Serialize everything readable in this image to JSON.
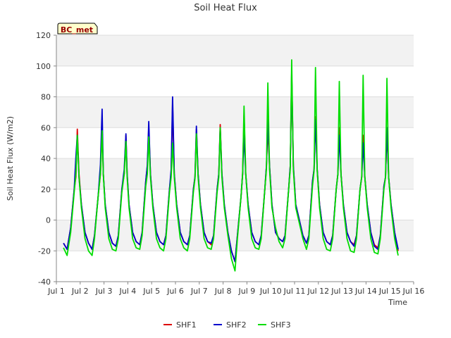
{
  "chart_data": {
    "type": "line",
    "title": "Soil Heat Flux",
    "badge": "BC_met",
    "xlabel": "Time",
    "ylabel": "Soil Heat Flux (W/m2)",
    "xlim": [
      1,
      16
    ],
    "ylim": [
      -40,
      120
    ],
    "yticks": [
      -40,
      -20,
      0,
      20,
      40,
      60,
      80,
      100,
      120
    ],
    "xticks": [
      {
        "v": 1,
        "label": "Jul 1"
      },
      {
        "v": 2,
        "label": "Jul 2"
      },
      {
        "v": 3,
        "label": "Jul 3"
      },
      {
        "v": 4,
        "label": "Jul 4"
      },
      {
        "v": 5,
        "label": "Jul 5"
      },
      {
        "v": 6,
        "label": "Jul 6"
      },
      {
        "v": 7,
        "label": "Jul 7"
      },
      {
        "v": 8,
        "label": "Jul 8"
      },
      {
        "v": 9,
        "label": "Jul 9"
      },
      {
        "v": 10,
        "label": "Jul 10"
      },
      {
        "v": 11,
        "label": "Jul 11"
      },
      {
        "v": 12,
        "label": "Jul 12"
      },
      {
        "v": 13,
        "label": "Jul 13"
      },
      {
        "v": 14,
        "label": "Jul 14"
      },
      {
        "v": 15,
        "label": "Jul 15"
      },
      {
        "v": 16,
        "label": "Jul 16"
      }
    ],
    "grid": true,
    "legend_position": "bottom",
    "series": [
      {
        "name": "SHF1",
        "color": "#dd0000",
        "x": [
          1.3,
          1.45,
          1.6,
          1.75,
          1.82,
          1.88,
          1.95,
          2.05,
          2.2,
          2.35,
          2.5,
          2.6,
          2.75,
          2.85,
          2.92,
          2.97,
          3.05,
          3.2,
          3.35,
          3.5,
          3.6,
          3.75,
          3.85,
          3.92,
          3.97,
          4.05,
          4.2,
          4.35,
          4.5,
          4.6,
          4.75,
          4.82,
          4.88,
          4.95,
          5.05,
          5.2,
          5.35,
          5.5,
          5.6,
          5.75,
          5.82,
          5.88,
          5.95,
          6.05,
          6.2,
          6.35,
          6.5,
          6.6,
          6.75,
          6.82,
          6.88,
          6.95,
          7.05,
          7.2,
          7.35,
          7.5,
          7.6,
          7.75,
          7.82,
          7.88,
          7.95,
          8.05,
          8.2,
          8.35,
          8.5,
          8.6,
          8.75,
          8.82,
          8.88,
          8.95,
          9.05,
          9.2,
          9.35,
          9.5,
          9.6,
          9.75,
          9.82,
          9.88,
          9.95,
          10.05,
          10.2,
          10.35,
          10.5,
          10.6,
          10.75,
          10.82,
          10.88,
          10.95,
          11.05,
          11.2,
          11.35,
          11.5,
          11.6,
          11.75,
          11.82,
          11.88,
          11.95,
          12.05,
          12.2,
          12.35,
          12.5,
          12.6,
          12.75,
          12.82,
          12.88,
          12.95,
          13.05,
          13.2,
          13.35,
          13.5,
          13.6,
          13.75,
          13.82,
          13.88,
          13.95,
          14.05,
          14.2,
          14.35,
          14.5,
          14.6,
          14.75,
          14.82,
          14.88,
          14.95,
          15.05,
          15.2,
          15.35
        ],
        "y": [
          -15,
          -19,
          -5,
          20,
          28,
          59,
          30,
          10,
          -8,
          -15,
          -19,
          -10,
          15,
          30,
          60,
          30,
          10,
          -8,
          -15,
          -17,
          -10,
          20,
          30,
          55,
          30,
          10,
          -8,
          -14,
          -16,
          -8,
          25,
          35,
          60,
          30,
          10,
          -8,
          -14,
          -16,
          -10,
          20,
          30,
          75,
          30,
          10,
          -8,
          -14,
          -16,
          -10,
          20,
          28,
          59,
          30,
          10,
          -8,
          -14,
          -16,
          -10,
          20,
          30,
          62,
          30,
          10,
          -8,
          -20,
          -27,
          -10,
          15,
          30,
          68,
          30,
          10,
          -8,
          -14,
          -16,
          -10,
          20,
          35,
          60,
          35,
          10,
          -8,
          -12,
          -14,
          -10,
          20,
          35,
          95,
          35,
          10,
          0,
          -10,
          -15,
          -10,
          25,
          33,
          67,
          33,
          10,
          -8,
          -14,
          -16,
          -10,
          20,
          30,
          60,
          30,
          10,
          -8,
          -14,
          -16,
          -10,
          20,
          28,
          55,
          28,
          10,
          -8,
          -16,
          -18,
          -10,
          22,
          28,
          58,
          28,
          10,
          -8,
          -20
        ]
      },
      {
        "name": "SHF2",
        "color": "#0000cc",
        "x": [
          1.3,
          1.45,
          1.6,
          1.75,
          1.82,
          1.88,
          1.95,
          2.05,
          2.2,
          2.35,
          2.5,
          2.6,
          2.75,
          2.85,
          2.92,
          2.97,
          3.05,
          3.2,
          3.35,
          3.5,
          3.6,
          3.75,
          3.85,
          3.92,
          3.97,
          4.05,
          4.2,
          4.35,
          4.5,
          4.6,
          4.75,
          4.82,
          4.88,
          4.95,
          5.05,
          5.2,
          5.35,
          5.5,
          5.6,
          5.75,
          5.82,
          5.88,
          5.95,
          6.05,
          6.2,
          6.35,
          6.5,
          6.6,
          6.75,
          6.82,
          6.88,
          6.95,
          7.05,
          7.2,
          7.35,
          7.5,
          7.6,
          7.75,
          7.82,
          7.88,
          7.95,
          8.05,
          8.2,
          8.35,
          8.5,
          8.6,
          8.75,
          8.82,
          8.88,
          8.95,
          9.05,
          9.2,
          9.35,
          9.5,
          9.6,
          9.75,
          9.82,
          9.88,
          9.95,
          10.05,
          10.2,
          10.35,
          10.5,
          10.6,
          10.75,
          10.82,
          10.88,
          10.95,
          11.05,
          11.2,
          11.35,
          11.5,
          11.6,
          11.75,
          11.82,
          11.88,
          11.95,
          12.05,
          12.2,
          12.35,
          12.5,
          12.6,
          12.75,
          12.82,
          12.88,
          12.95,
          13.05,
          13.2,
          13.35,
          13.5,
          13.6,
          13.75,
          13.82,
          13.88,
          13.95,
          14.05,
          14.2,
          14.35,
          14.5,
          14.6,
          14.75,
          14.82,
          14.88,
          14.95,
          15.05,
          15.2,
          15.35
        ],
        "y": [
          -15,
          -19,
          -5,
          20,
          41,
          55,
          28,
          10,
          -8,
          -15,
          -19,
          -10,
          15,
          36,
          72,
          30,
          10,
          -8,
          -15,
          -17,
          -10,
          20,
          33,
          56,
          30,
          10,
          -8,
          -14,
          -16,
          -8,
          25,
          36,
          64,
          30,
          10,
          -8,
          -14,
          -16,
          -10,
          20,
          33,
          80,
          30,
          10,
          -8,
          -14,
          -16,
          -10,
          20,
          28,
          61,
          30,
          10,
          -8,
          -14,
          -15,
          -10,
          20,
          30,
          60,
          30,
          10,
          -8,
          -20,
          -27,
          -10,
          15,
          30,
          55,
          30,
          10,
          -8,
          -14,
          -16,
          -10,
          20,
          35,
          65,
          35,
          10,
          -8,
          -12,
          -14,
          -10,
          20,
          35,
          95,
          35,
          10,
          0,
          -10,
          -15,
          -10,
          25,
          33,
          65,
          33,
          10,
          -8,
          -14,
          -16,
          -10,
          20,
          30,
          55,
          30,
          10,
          -8,
          -14,
          -17,
          -10,
          20,
          28,
          50,
          28,
          10,
          -8,
          -17,
          -19,
          -10,
          22,
          28,
          60,
          28,
          10,
          -8,
          -19
        ]
      },
      {
        "name": "SHF3",
        "color": "#00dd00",
        "x": [
          1.3,
          1.45,
          1.6,
          1.75,
          1.82,
          1.88,
          1.95,
          2.05,
          2.2,
          2.35,
          2.5,
          2.6,
          2.75,
          2.85,
          2.92,
          2.97,
          3.05,
          3.2,
          3.35,
          3.5,
          3.6,
          3.75,
          3.85,
          3.92,
          3.97,
          4.05,
          4.2,
          4.35,
          4.5,
          4.6,
          4.75,
          4.82,
          4.88,
          4.95,
          5.05,
          5.2,
          5.35,
          5.5,
          5.6,
          5.75,
          5.82,
          5.88,
          5.95,
          6.05,
          6.2,
          6.35,
          6.5,
          6.6,
          6.75,
          6.82,
          6.88,
          6.95,
          7.05,
          7.2,
          7.35,
          7.5,
          7.6,
          7.75,
          7.82,
          7.88,
          7.95,
          8.05,
          8.2,
          8.35,
          8.5,
          8.6,
          8.75,
          8.82,
          8.88,
          8.95,
          9.05,
          9.2,
          9.35,
          9.5,
          9.6,
          9.75,
          9.82,
          9.88,
          9.95,
          10.05,
          10.2,
          10.35,
          10.5,
          10.6,
          10.75,
          10.82,
          10.88,
          10.95,
          11.05,
          11.2,
          11.35,
          11.5,
          11.6,
          11.75,
          11.82,
          11.88,
          11.95,
          12.05,
          12.2,
          12.35,
          12.5,
          12.6,
          12.75,
          12.82,
          12.88,
          12.95,
          13.05,
          13.2,
          13.35,
          13.5,
          13.6,
          13.75,
          13.82,
          13.88,
          13.95,
          14.05,
          14.2,
          14.35,
          14.5,
          14.6,
          14.75,
          14.82,
          14.88,
          14.95,
          15.05,
          15.2,
          15.35
        ],
        "y": [
          -18,
          -23,
          -8,
          18,
          30,
          55,
          28,
          8,
          -12,
          -20,
          -23,
          -12,
          15,
          30,
          58,
          30,
          8,
          -12,
          -19,
          -20,
          -12,
          18,
          30,
          51,
          28,
          8,
          -12,
          -18,
          -19,
          -10,
          22,
          30,
          54,
          28,
          8,
          -12,
          -18,
          -20,
          -12,
          18,
          28,
          50,
          28,
          8,
          -12,
          -18,
          -20,
          -12,
          18,
          27,
          56,
          28,
          8,
          -12,
          -18,
          -19,
          -12,
          18,
          28,
          60,
          28,
          8,
          -10,
          -25,
          -33,
          -12,
          15,
          30,
          74,
          30,
          8,
          -12,
          -18,
          -19,
          -12,
          20,
          33,
          89,
          33,
          8,
          -5,
          -14,
          -18,
          -12,
          20,
          33,
          104,
          33,
          8,
          -2,
          -12,
          -19,
          -12,
          22,
          32,
          99,
          32,
          8,
          -12,
          -19,
          -20,
          -12,
          20,
          30,
          90,
          30,
          8,
          -12,
          -20,
          -21,
          -12,
          20,
          28,
          94,
          28,
          8,
          -12,
          -21,
          -22,
          -12,
          20,
          28,
          92,
          28,
          8,
          -12,
          -23
        ]
      }
    ]
  }
}
